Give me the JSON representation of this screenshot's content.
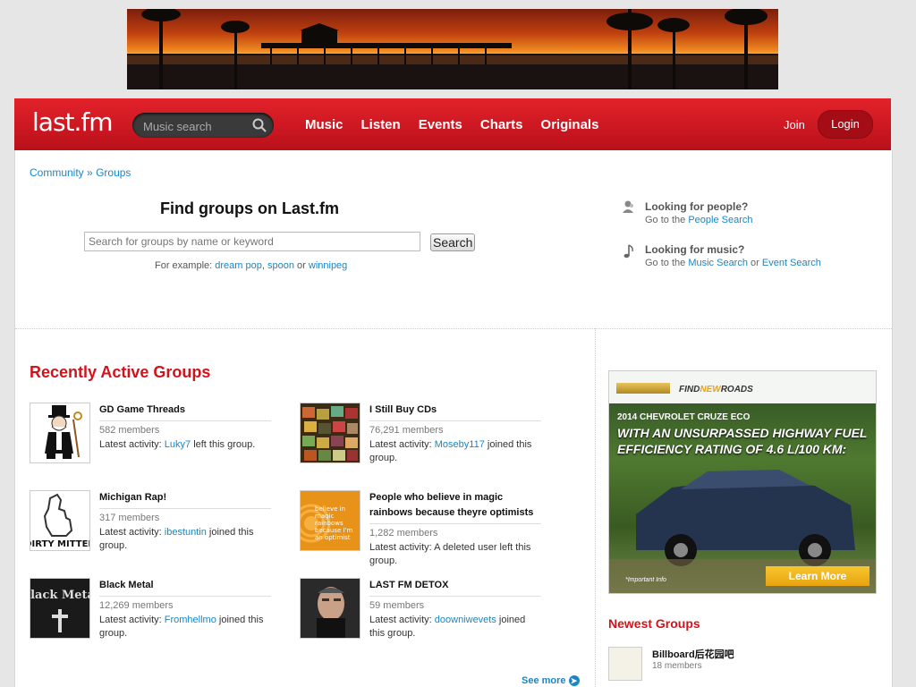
{
  "header": {
    "logo": "last.fm",
    "search_placeholder": "Music search",
    "nav": [
      "Music",
      "Listen",
      "Events",
      "Charts",
      "Originals"
    ],
    "join": "Join",
    "login": "Login"
  },
  "breadcrumb": {
    "community": "Community",
    "sep": "»",
    "groups": "Groups"
  },
  "find": {
    "title": "Find groups on Last.fm",
    "placeholder": "Search for groups by name or keyword",
    "button": "Search",
    "example_prefix": "For example:",
    "examples": [
      "dream pop",
      "spoon",
      "winnipeg"
    ],
    "comma": ",",
    "or": "or"
  },
  "side_help": {
    "people": {
      "title": "Looking for people?",
      "go": "Go to the",
      "link": "People Search"
    },
    "music": {
      "title": "Looking for music?",
      "go": "Go to the",
      "link1": "Music Search",
      "or": "or",
      "link2": "Event Search"
    }
  },
  "recent": {
    "title": "Recently Active Groups",
    "label": "Latest activity:",
    "groups": [
      {
        "name": "GD Game Threads",
        "members": "582 members",
        "user": "Luky7",
        "action": "left this group."
      },
      {
        "name": "I Still Buy CDs",
        "members": "76,291 members",
        "user": "Moseby117",
        "action": "joined this group."
      },
      {
        "name": "Michigan Rap!",
        "members": "317 members",
        "user": "ibestuntin",
        "action": "joined this group."
      },
      {
        "name": "People who believe in magic rainbows because theyre optimists",
        "members": "1,282 members",
        "user": "",
        "action": "A deleted user left this group."
      },
      {
        "name": "Black Metal",
        "members": "12,269 members",
        "user": "Fromhellmo",
        "action": "joined this group."
      },
      {
        "name": "LAST FM DETOX",
        "members": "59 members",
        "user": "doowniwevets",
        "action": "joined this group."
      }
    ],
    "see_more": "See more"
  },
  "ad": {
    "find_new": "FIND",
    "find_new_accent": "NEW",
    "find_new_end": "ROADS",
    "model": "2014 CHEVROLET CRUZE ECO",
    "headline": "WITH AN UNSURPASSED HIGHWAY FUEL EFFICIENCY RATING OF 4.6 L/100 KM:",
    "cta": "Learn More",
    "fine": "*Important Info"
  },
  "newest": {
    "title": "Newest Groups",
    "items": [
      {
        "name": "Billboard后花园吧",
        "members": "18 members"
      }
    ]
  },
  "thumb_text": {
    "michigan": "DIRTY MITTEN",
    "black_metal": "Black Metal",
    "rainbow": "believe in magic rainbows because I'm an optimist"
  }
}
